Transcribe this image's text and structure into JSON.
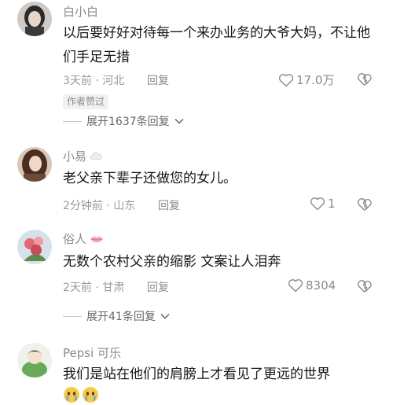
{
  "comments": [
    {
      "username": "白小白",
      "text": "以后要好好对待每一个来办业务的大爷大妈，不让他们手足无措",
      "time_location": "3天前 · 河北",
      "reply_label": "回复",
      "likes": "17.0万",
      "badge": "作者赞过",
      "expand_label": "展开1637条回复"
    },
    {
      "username": "小易",
      "text": "老父亲下辈子还做您的女儿。",
      "time_location": "2分钟前 · 山东",
      "reply_label": "回复",
      "likes": "1"
    },
    {
      "username": "俗人",
      "text": "无数个农村父亲的缩影 文案让人泪奔",
      "time_location": "2天前 · 甘肃",
      "reply_label": "回复",
      "likes": "8304",
      "expand_label": "展开41条回复"
    },
    {
      "username": "Pepsi 可乐",
      "text": "我们是站在他们的肩膀上才看见了更远的世界"
    }
  ],
  "icons": {
    "like": "heart-outline-icon",
    "dislike": "broken-heart-icon",
    "expand": "chevron-down-icon"
  }
}
